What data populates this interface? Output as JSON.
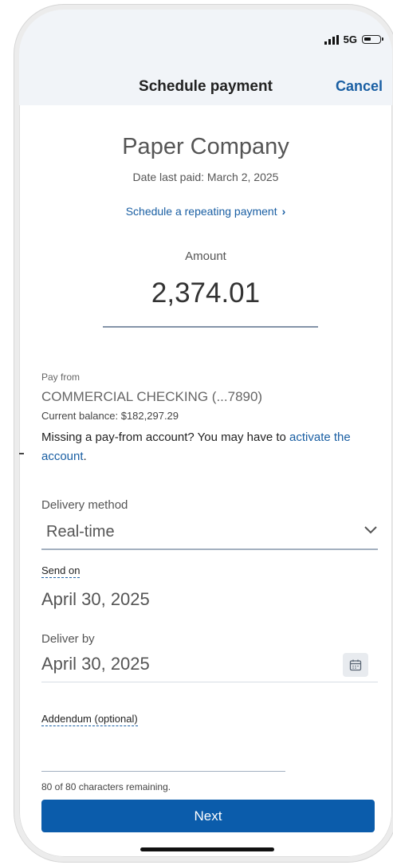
{
  "status": {
    "network": "5G",
    "battery_level": 0.4
  },
  "nav": {
    "title": "Schedule payment",
    "cancel_label": "Cancel"
  },
  "payee": {
    "name": "Paper Company",
    "last_paid": "Date last paid: March 2, 2025",
    "repeat_link": "Schedule a repeating payment",
    "repeat_chevron": "›"
  },
  "amount": {
    "label": "Amount",
    "value": "2,374.01"
  },
  "pay_from": {
    "label": "Pay from",
    "account": "COMMERCIAL CHECKING (...7890)",
    "balance": "Current balance: $182,297.29",
    "missing_text": "Missing a pay-from account? You may have to ",
    "activate_link": "activate the account",
    "missing_end": "."
  },
  "delivery": {
    "label": "Delivery method",
    "value": "Real-time",
    "icon": "chevron-down-icon"
  },
  "send_on": {
    "label": "Send on",
    "value": "April 30, 2025"
  },
  "deliver_by": {
    "label": "Deliver by",
    "value": "April 30, 2025",
    "icon": "calendar-icon"
  },
  "addendum": {
    "label": "Addendum (optional)",
    "value": "",
    "remaining": "80 of 80 characters remaining."
  },
  "next_button": {
    "label": "Next"
  },
  "colors": {
    "accent": "#1a5fa3",
    "primary_button": "#0b5cab",
    "header_bg": "#f1f4f8"
  }
}
